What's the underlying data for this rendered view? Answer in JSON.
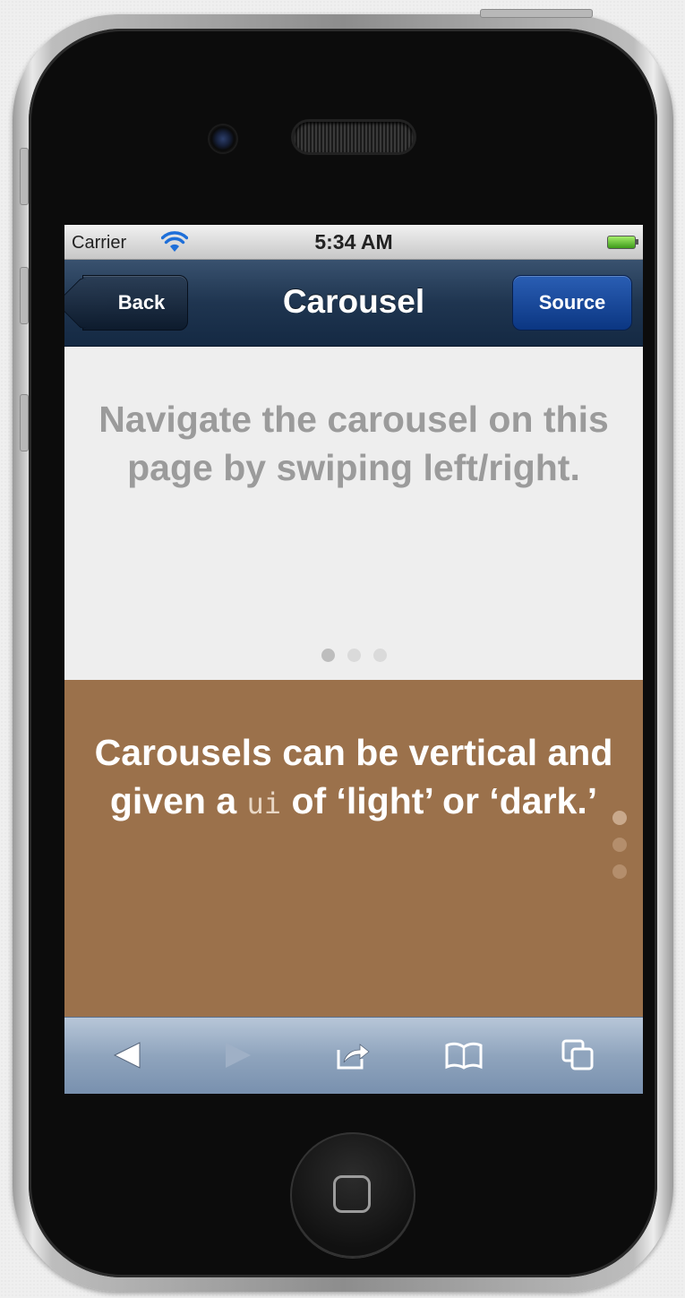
{
  "status_bar": {
    "carrier": "Carrier",
    "time": "5:34 AM",
    "icons": [
      "wifi-icon",
      "battery-icon"
    ]
  },
  "nav_bar": {
    "back_label": "Back",
    "title": "Carousel",
    "source_label": "Source"
  },
  "carousel_horizontal": {
    "text": "Navigate the carousel on this page by swiping left/right.",
    "page_count": 3,
    "active_index": 0,
    "background": "#eeeeee",
    "text_color": "#9b9b9b"
  },
  "carousel_vertical": {
    "text_before": "Carousels can be vertical and given a ",
    "code": "ui",
    "text_after": " of ‘light’ or ‘dark.’",
    "page_count": 3,
    "active_index": 0,
    "background": "#9b714b"
  },
  "toolbar": {
    "icons": [
      "back-arrow-icon",
      "forward-arrow-icon",
      "share-icon",
      "bookmarks-icon",
      "tabs-icon"
    ]
  },
  "colors": {
    "nav_bar": "#1f3550",
    "source_button": "#0b3682",
    "toolbar": "#8fa4bd"
  }
}
